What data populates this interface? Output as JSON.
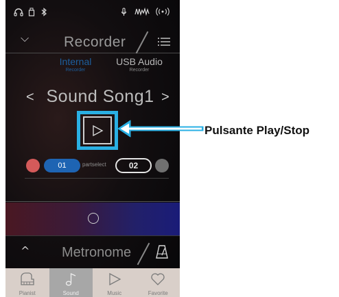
{
  "recorder": {
    "title": "Recorder",
    "modes": [
      {
        "label": "Internal",
        "sub": "Recorder"
      },
      {
        "label": "USB Audio",
        "sub": "Recorder"
      }
    ]
  },
  "song": {
    "name": "Sound Song1",
    "prev": "<",
    "next": ">"
  },
  "parts": {
    "part1": "01",
    "select_label": "partselect",
    "part2": "02"
  },
  "metronome": {
    "title": "Metronome"
  },
  "nav": [
    {
      "label": "Pianist",
      "icon": "piano-icon"
    },
    {
      "label": "Sound",
      "icon": "note-icon"
    },
    {
      "label": "Music",
      "icon": "play-icon"
    },
    {
      "label": "Favorite",
      "icon": "heart-icon"
    }
  ],
  "callout": {
    "label": "Pulsante Play/Stop"
  },
  "colors": {
    "highlight": "#2ab0e4",
    "active_mode": "#1d5f9e",
    "part1": "#1e64b3",
    "dot_red": "#d45a5a"
  }
}
